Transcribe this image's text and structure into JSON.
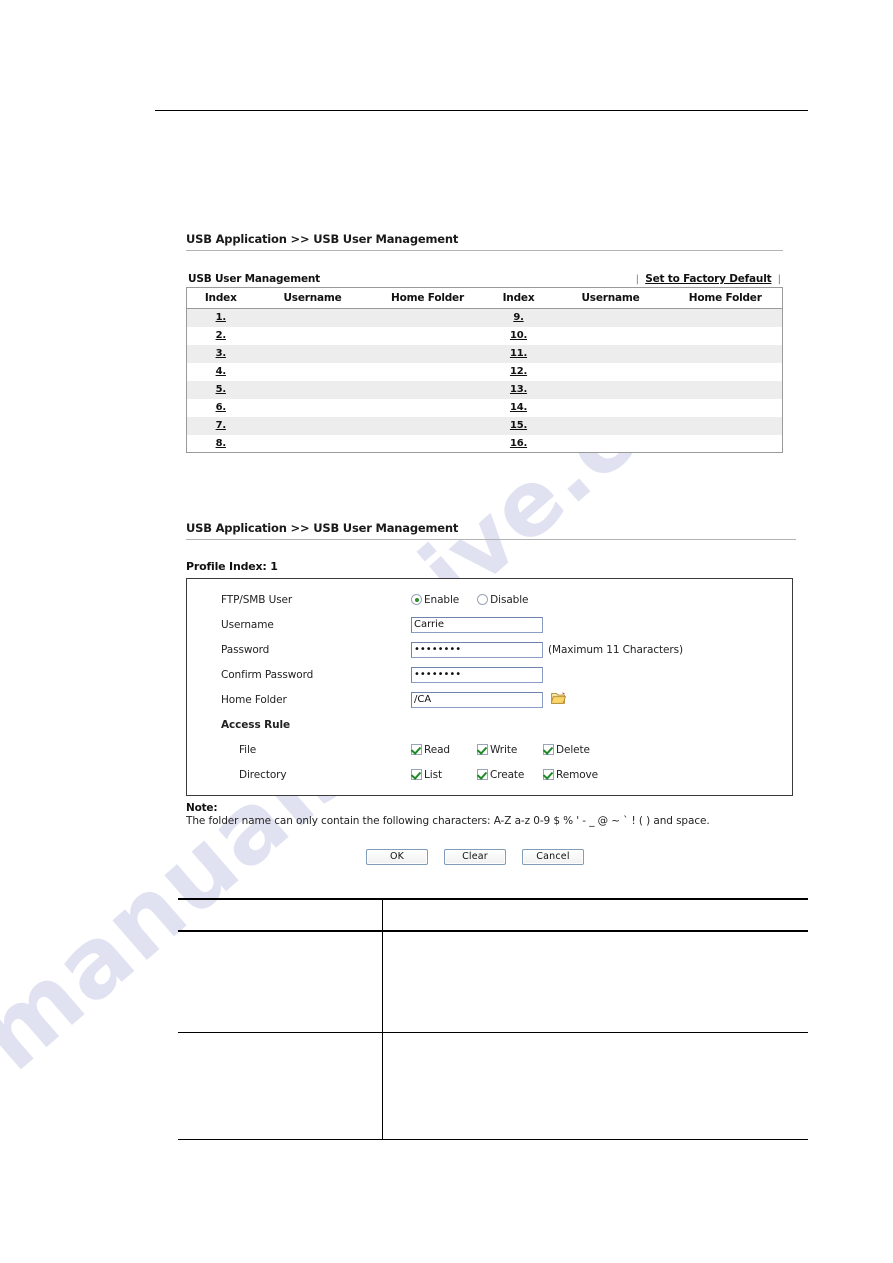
{
  "watermark": {
    "text_a": "manualshive.",
    "text_b": "ive.com"
  },
  "block1": {
    "breadcrumb": "USB Application >> USB User Management",
    "bar_label": "USB User Management",
    "factory_default_link": "Set to Factory Default",
    "separator": "|",
    "columns": [
      "Index",
      "Username",
      "Home Folder",
      "Index",
      "Username",
      "Home Folder"
    ],
    "rows": [
      {
        "left_index": "1.",
        "left_username": "",
        "left_home": "",
        "right_index": "9.",
        "right_username": "",
        "right_home": ""
      },
      {
        "left_index": "2.",
        "left_username": "",
        "left_home": "",
        "right_index": "10.",
        "right_username": "",
        "right_home": ""
      },
      {
        "left_index": "3.",
        "left_username": "",
        "left_home": "",
        "right_index": "11.",
        "right_username": "",
        "right_home": ""
      },
      {
        "left_index": "4.",
        "left_username": "",
        "left_home": "",
        "right_index": "12.",
        "right_username": "",
        "right_home": ""
      },
      {
        "left_index": "5.",
        "left_username": "",
        "left_home": "",
        "right_index": "13.",
        "right_username": "",
        "right_home": ""
      },
      {
        "left_index": "6.",
        "left_username": "",
        "left_home": "",
        "right_index": "14.",
        "right_username": "",
        "right_home": ""
      },
      {
        "left_index": "7.",
        "left_username": "",
        "left_home": "",
        "right_index": "15.",
        "right_username": "",
        "right_home": ""
      },
      {
        "left_index": "8.",
        "left_username": "",
        "left_home": "",
        "right_index": "16.",
        "right_username": "",
        "right_home": ""
      }
    ]
  },
  "block2": {
    "breadcrumb": "USB Application >> USB User Management",
    "profile_index": "Profile Index: 1",
    "ftp_smb_label": "FTP/SMB User",
    "enable_label": "Enable",
    "disable_label": "Disable",
    "ftp_smb_value": "Enable",
    "username_label": "Username",
    "username_value": "Carrie",
    "password_label": "Password",
    "password_value": "••••••••",
    "password_hint": "(Maximum 11 Characters)",
    "confirm_password_label": "Confirm Password",
    "confirm_password_value": "••••••••",
    "home_folder_label": "Home Folder",
    "home_folder_value": "/CA",
    "folder_browse_icon": "folder-icon",
    "access_rule_label": "Access Rule",
    "file_label": "File",
    "directory_label": "Directory",
    "file_permissions": [
      {
        "label": "Read",
        "checked": true
      },
      {
        "label": "Write",
        "checked": true
      },
      {
        "label": "Delete",
        "checked": true
      }
    ],
    "directory_permissions": [
      {
        "label": "List",
        "checked": true
      },
      {
        "label": "Create",
        "checked": true
      },
      {
        "label": "Remove",
        "checked": true
      }
    ],
    "note_title": "Note:",
    "note_body": "The folder name can only contain the following characters: A-Z a-z 0-9 $ % ' - _ @ ~ ` ! ( ) and space.",
    "buttons": {
      "ok": "OK",
      "clear": "Clear",
      "cancel": "Cancel"
    }
  },
  "bottom_table": {
    "header_col1": "",
    "header_col2": "",
    "row1_col1": "",
    "row1_col2": "",
    "row2_col1": "",
    "row2_col2": ""
  },
  "colors": {
    "accent_green": "#2f8f2f",
    "row_shade": "#ededed",
    "input_border": "#8b9dc3",
    "folder_icon": "#f0c060"
  }
}
